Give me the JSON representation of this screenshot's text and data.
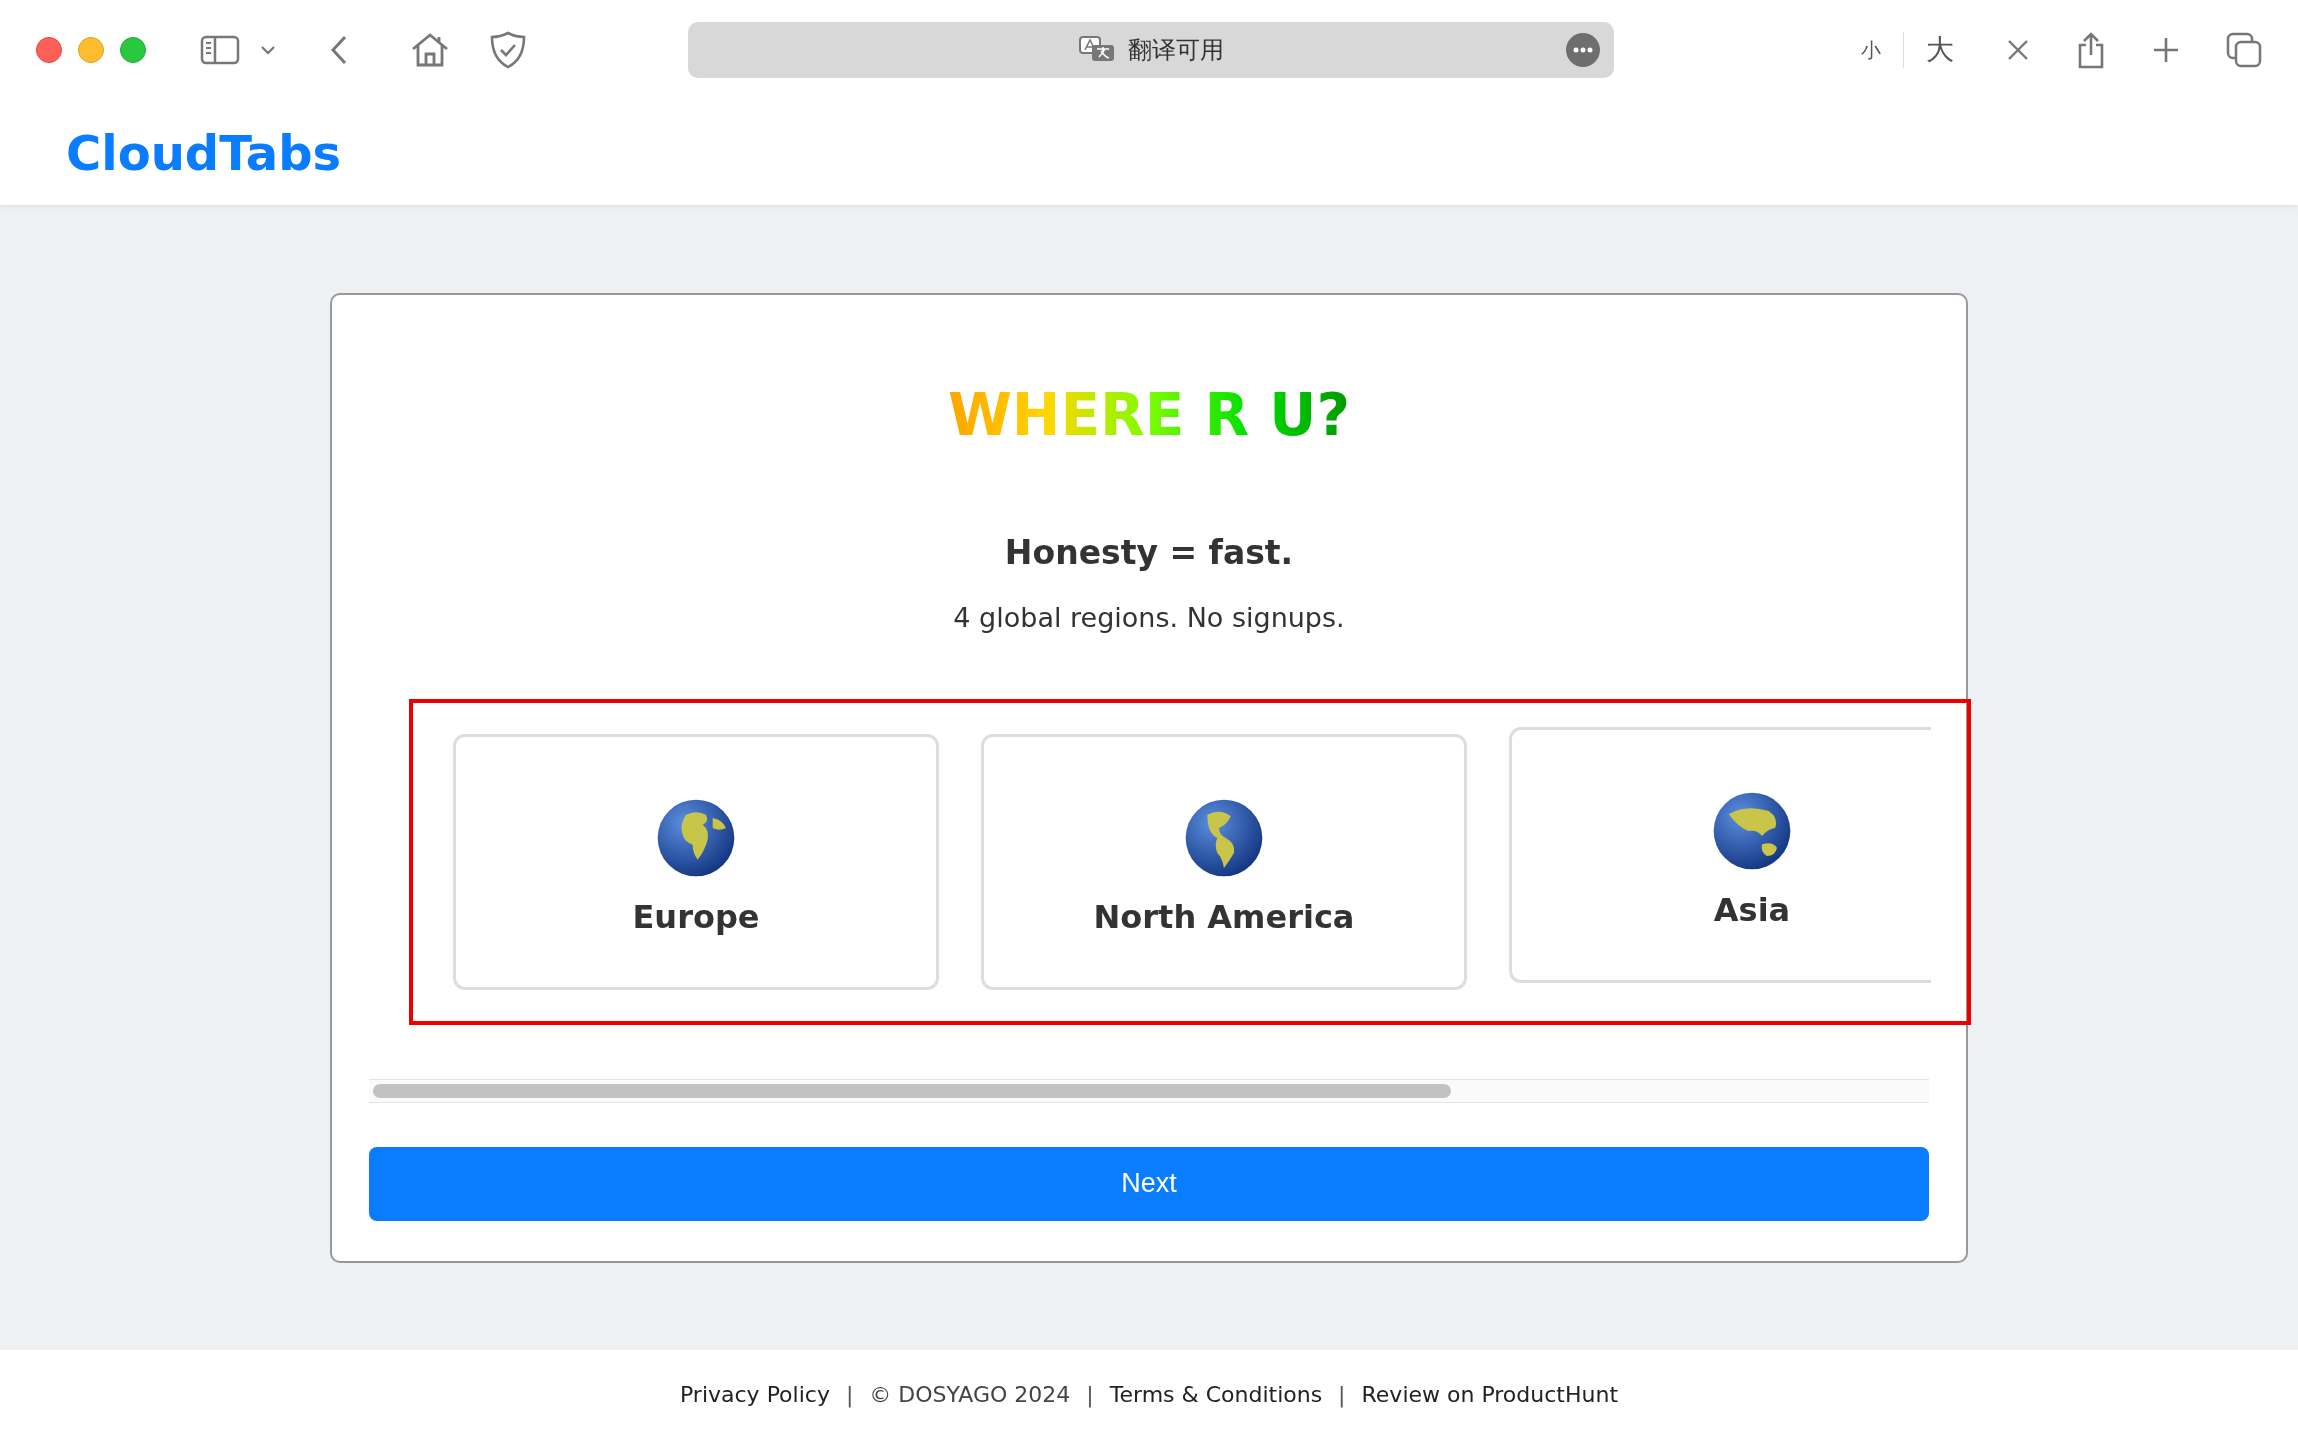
{
  "browser": {
    "address": "翻译可用",
    "text_size_buttons": [
      "小",
      "大"
    ]
  },
  "site": {
    "logo": "CloudTabs"
  },
  "dialog": {
    "title": "WHERE R U?",
    "tagline": "Honesty = fast.",
    "subtitle": "4 global regions. No signups.",
    "regions": [
      {
        "name": "Europe",
        "kind": "africa-europe"
      },
      {
        "name": "North America",
        "kind": "americas"
      },
      {
        "name": "Asia",
        "kind": "asia-australia"
      }
    ],
    "next_button": "Next"
  },
  "footer": [
    {
      "kind": "link",
      "text": "Privacy Policy"
    },
    {
      "kind": "separator",
      "text": "|"
    },
    {
      "kind": "text",
      "text": "© DOSYAGO 2024"
    },
    {
      "kind": "separator",
      "text": "|"
    },
    {
      "kind": "link",
      "text": "Terms & Conditions"
    },
    {
      "kind": "separator",
      "text": "|"
    },
    {
      "kind": "link",
      "text": "Review on ProductHunt"
    }
  ]
}
